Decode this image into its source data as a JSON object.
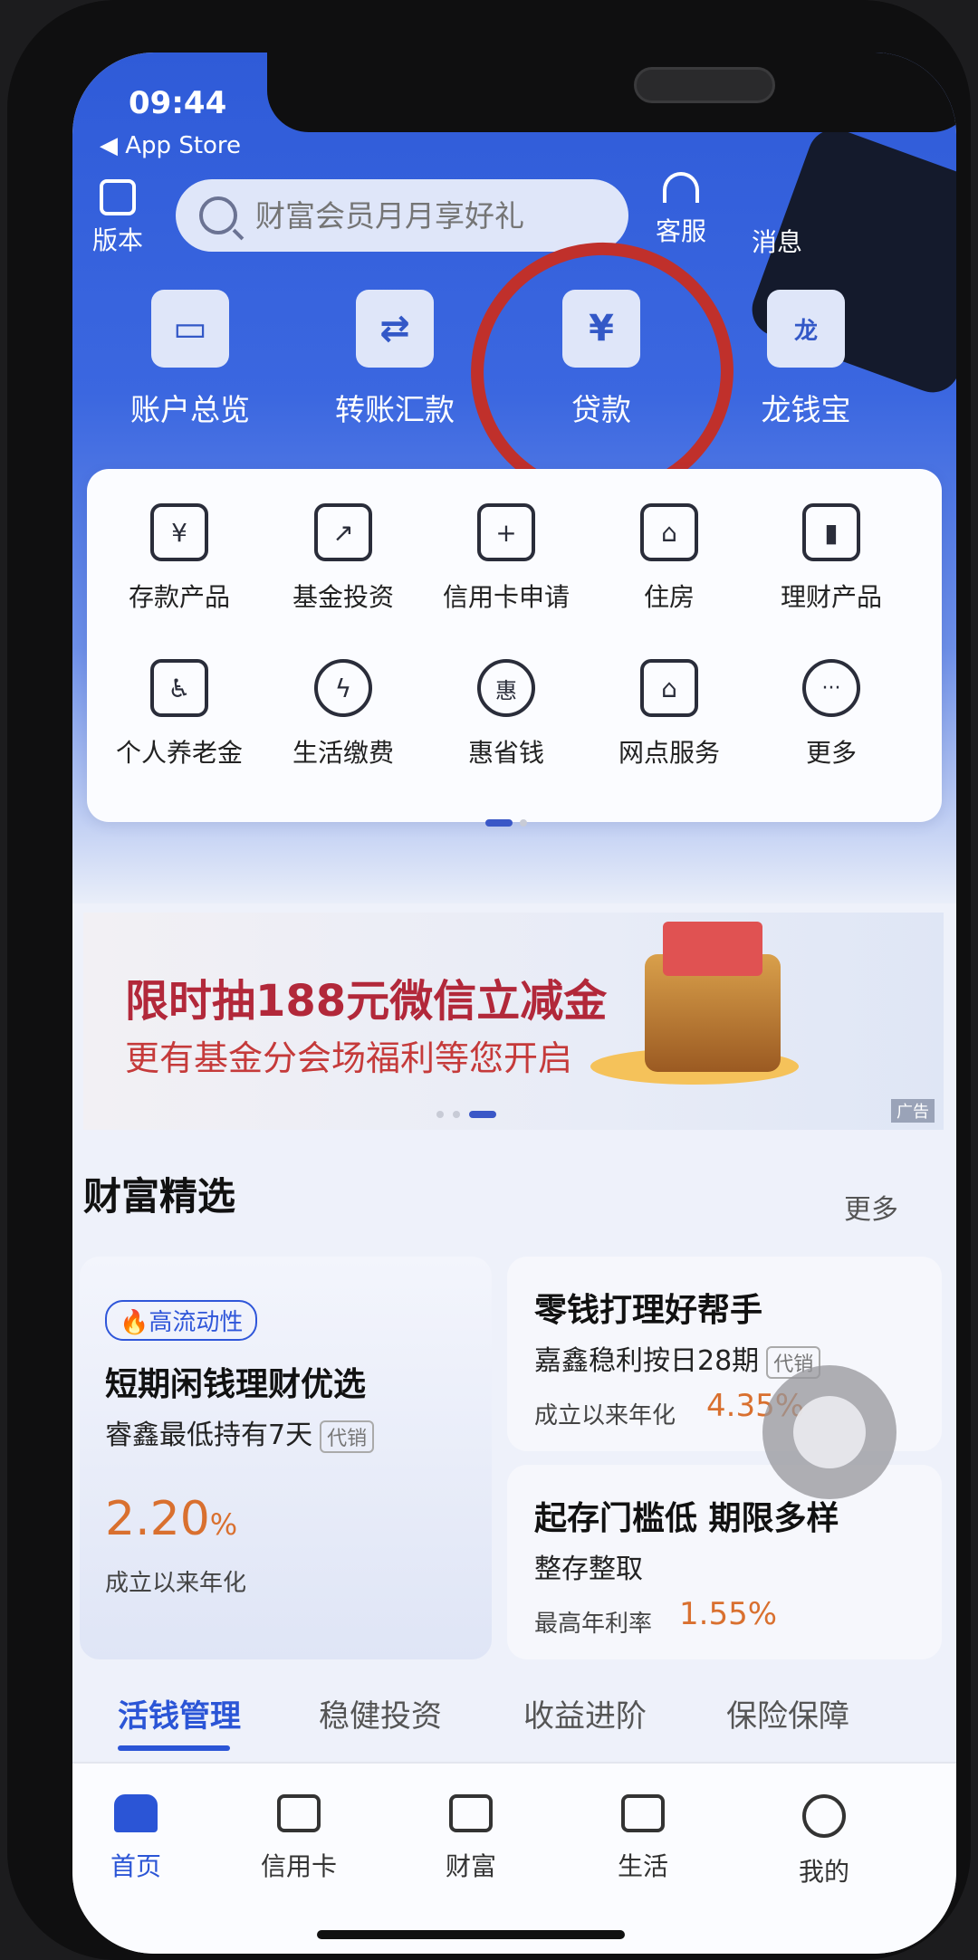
{
  "status": {
    "time": "09:44",
    "back": "◀ App Store"
  },
  "header": {
    "version_label": "版本",
    "search_placeholder": "财富会员月月享好礼",
    "service_label": "客服",
    "message_label": "消息"
  },
  "quick_actions": [
    {
      "label": "账户总览",
      "icon": "wallet-icon",
      "glyph": "▭"
    },
    {
      "label": "转账汇款",
      "icon": "transfer-icon",
      "glyph": "⇄"
    },
    {
      "label": "贷款",
      "icon": "money-bag-icon",
      "glyph": "¥"
    },
    {
      "label": "龙钱宝",
      "icon": "dragon-bag-icon",
      "glyph": "龙"
    }
  ],
  "grid": [
    {
      "label": "存款产品",
      "icon": "deposit-icon",
      "glyph": "¥"
    },
    {
      "label": "基金投资",
      "icon": "fund-chart-icon",
      "glyph": "↗"
    },
    {
      "label": "信用卡申请",
      "icon": "card-add-icon",
      "glyph": "+"
    },
    {
      "label": "住房",
      "icon": "house-icon",
      "glyph": "⌂"
    },
    {
      "label": "理财产品",
      "icon": "bar-chart-icon",
      "glyph": "▮"
    },
    {
      "label": "个人养老金",
      "icon": "pension-shield-icon",
      "glyph": "♿"
    },
    {
      "label": "生活缴费",
      "icon": "lightning-drop-icon",
      "glyph": "ϟ"
    },
    {
      "label": "惠省钱",
      "icon": "savings-bag-icon",
      "glyph": "惠"
    },
    {
      "label": "网点服务",
      "icon": "branch-location-icon",
      "glyph": "⌂"
    },
    {
      "label": "更多",
      "icon": "more-icon",
      "glyph": "···"
    }
  ],
  "banner": {
    "title": "限时抽188元微信立减金",
    "subtitle": "更有基金分会场福利等您开启",
    "ad_tag": "广告"
  },
  "section": {
    "title": "财富精选",
    "more": "更多"
  },
  "products": {
    "big": {
      "tag": "🔥高流动性",
      "title": "短期闲钱理财优选",
      "subtitle": "睿鑫最低持有7天",
      "agent": "代销",
      "rate": "2.20",
      "rate_unit": "%",
      "note": "成立以来年化"
    },
    "small1": {
      "title": "零钱打理好帮手",
      "subtitle": "嘉鑫稳利按日28期",
      "agent": "代销",
      "note": "成立以来年化",
      "rate": "4.35%"
    },
    "small2": {
      "title": "起存门槛低 期限多样",
      "subtitle": "整存整取",
      "note": "最高年利率",
      "rate": "1.55%"
    }
  },
  "tabs": [
    "活钱管理",
    "稳健投资",
    "收益进阶",
    "保险保障"
  ],
  "bottom_nav": [
    {
      "label": "首页",
      "icon": "home-icon"
    },
    {
      "label": "信用卡",
      "icon": "credit-card-icon"
    },
    {
      "label": "财富",
      "icon": "wallet-icon"
    },
    {
      "label": "生活",
      "icon": "cup-icon"
    },
    {
      "label": "我的",
      "icon": "smile-icon"
    }
  ],
  "colors": {
    "primary": "#2b55d6",
    "accent_orange": "#d9702f",
    "annotation_red": "#c0302b"
  }
}
